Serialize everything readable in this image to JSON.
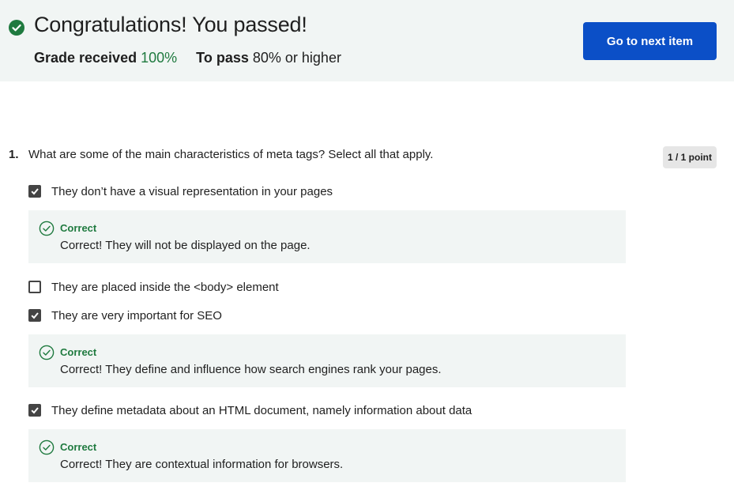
{
  "banner": {
    "title": "Congratulations! You passed!",
    "grade_label": "Grade received",
    "grade_value": "100%",
    "pass_label": "To pass",
    "pass_value": "80% or higher",
    "next_button": "Go to next item"
  },
  "question": {
    "number": "1.",
    "text": "What are some of the main characteristics of meta tags? Select all that apply.",
    "points": "1 / 1 point",
    "options": [
      {
        "label": "They don’t have a visual representation in your pages",
        "checked": true
      },
      {
        "label": "They are placed inside the <body> element",
        "checked": false
      },
      {
        "label": "They are very important for SEO",
        "checked": true
      },
      {
        "label": "They define metadata about an HTML document, namely information about data",
        "checked": true
      }
    ],
    "feedback": [
      {
        "title": "Correct",
        "text": "Correct! They will not be displayed on the page."
      },
      {
        "title": "Correct",
        "text": "Correct! They define and influence how search engines rank your pages."
      },
      {
        "title": "Correct",
        "text": "Correct! They are contextual information for browsers."
      }
    ]
  },
  "colors": {
    "accent_blue": "#0b4fc7",
    "success_green": "#1f7a3f",
    "banner_bg": "#f1f5f4"
  }
}
